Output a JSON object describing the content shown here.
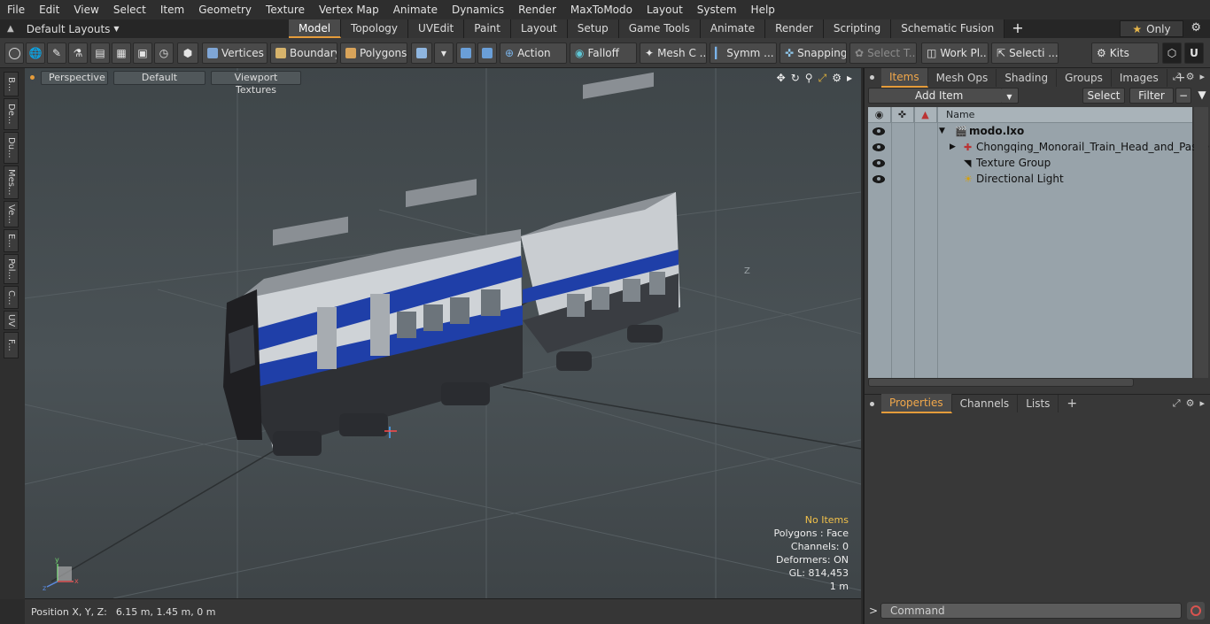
{
  "menu": [
    "File",
    "Edit",
    "View",
    "Select",
    "Item",
    "Geometry",
    "Texture",
    "Vertex Map",
    "Animate",
    "Dynamics",
    "Render",
    "MaxToModo",
    "Layout",
    "System",
    "Help"
  ],
  "layouts": {
    "label": "Default Layouts"
  },
  "tabs": [
    "Model",
    "Topology",
    "UVEdit",
    "Paint",
    "Layout",
    "Setup",
    "Game Tools",
    "Animate",
    "Render",
    "Scripting",
    "Schematic Fusion"
  ],
  "active_tab": "Model",
  "only_label": "Only",
  "toolbar": {
    "vertices": "Vertices",
    "boundary": "Boundary",
    "polygons": "Polygons",
    "action": "Action",
    "falloff": "Falloff",
    "mesh": "Mesh C ...",
    "symm": "Symm ...",
    "snapping": "Snapping",
    "select_t": "Select T...",
    "work_pl": "Work Pl...",
    "selecti": "Selecti ...",
    "kits": "Kits"
  },
  "left_tabs": [
    "B...",
    "De...",
    "Du...",
    "Mes...",
    "Ve...",
    "E...",
    "Pol...",
    "C...",
    "UV",
    "F..."
  ],
  "viewport": {
    "perspective": "Perspective",
    "default": "Default",
    "textures": "Viewport Textures",
    "axis_label": "Z",
    "hud": {
      "no_items": "No Items",
      "polygons": "Polygons : Face",
      "channels": "Channels: 0",
      "deformers": "Deformers: ON",
      "gl": "GL: 814,453",
      "scale": "1 m"
    }
  },
  "status": {
    "label": "Position X, Y, Z:",
    "value": "6.15 m, 1.45 m, 0 m"
  },
  "panel": {
    "tabs": [
      "Items",
      "Mesh Ops",
      "Shading",
      "Groups",
      "Images"
    ],
    "add_item": "Add Item",
    "select": "Select",
    "filter": "Filter",
    "name_col": "Name",
    "tree": [
      "modo.lxo",
      "Chongqing_Monorail_Train_Head_and_Passeng ...",
      "Texture Group",
      "Directional Light"
    ],
    "props_tabs": [
      "Properties",
      "Channels",
      "Lists"
    ],
    "command_placeholder": "Command"
  },
  "colors": {
    "accent": "#e59c3b",
    "train_blue": "#1f3fa8"
  }
}
